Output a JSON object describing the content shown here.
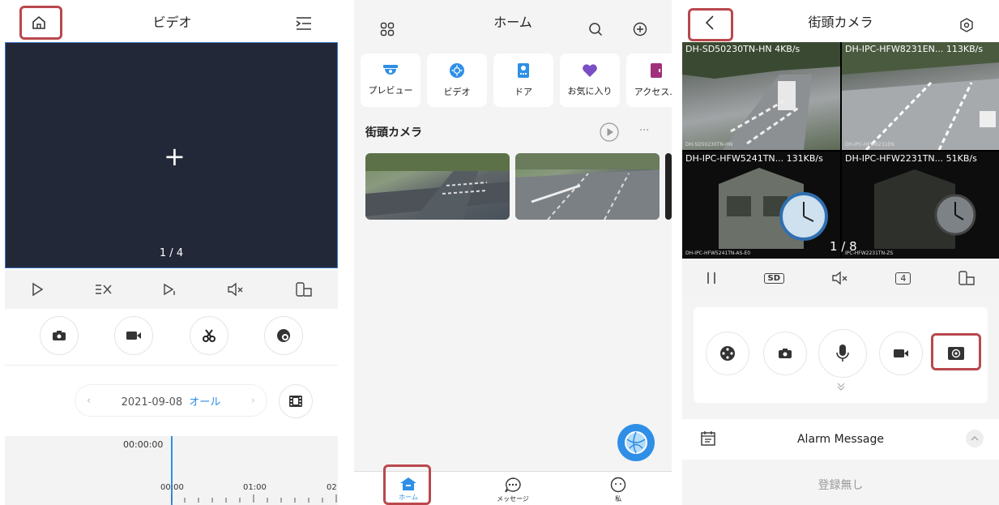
{
  "panel_video": {
    "title": "ビデオ",
    "page_indicator": "1 / 4",
    "plus_symbol": "+",
    "date": "2021-09-08",
    "filter": "オール",
    "timeline": {
      "cursor_time": "00:00:00",
      "ticks": [
        "00:00",
        "01:00",
        "02"
      ]
    }
  },
  "panel_home": {
    "title": "ホーム",
    "quick_items": [
      {
        "label": "プレビュー",
        "icon": "camera-dome-icon",
        "color": "#2f8fe6"
      },
      {
        "label": "ビデオ",
        "icon": "playback-icon",
        "color": "#2f8fe6"
      },
      {
        "label": "ドア",
        "icon": "door-icon",
        "color": "#2f8fe6"
      },
      {
        "label": "お気に入り",
        "icon": "heart-icon",
        "color": "#7a4fc6"
      },
      {
        "label": "アクセス…",
        "icon": "access-icon",
        "color": "#a0307a"
      }
    ],
    "section_title": "街頭カメラ",
    "more": "···",
    "tabs": [
      {
        "label": "ホーム"
      },
      {
        "label": "メッセージ"
      },
      {
        "label": "私"
      }
    ]
  },
  "panel_camera": {
    "title": "街頭カメラ",
    "cells": [
      {
        "label": "DH-SD50230TN-HN",
        "rate": "4KB/s",
        "caption": "DH-SD50230TN-HN"
      },
      {
        "label": "DH-IPC-HFW8231EN...",
        "rate": "113KB/s",
        "caption": "DH-IPC-HFW8231EN"
      },
      {
        "label": "DH-IPC-HFW5241TN...",
        "rate": "131KB/s",
        "caption": "DH-IPC-HFW5241TN-AS-E0"
      },
      {
        "label": "DH-IPC-HFW2231TN...",
        "rate": "51KB/s",
        "caption": "IPC-HFW2231TN-ZS"
      }
    ],
    "page_indicator": "1 / 8",
    "sd_label": "SD",
    "split_label": "4",
    "alarm_label": "Alarm Message",
    "no_records": "登録無し"
  },
  "colors": {
    "accent": "#2f8fe6",
    "highlight": "#b9484d",
    "video_bg": "#232838"
  }
}
